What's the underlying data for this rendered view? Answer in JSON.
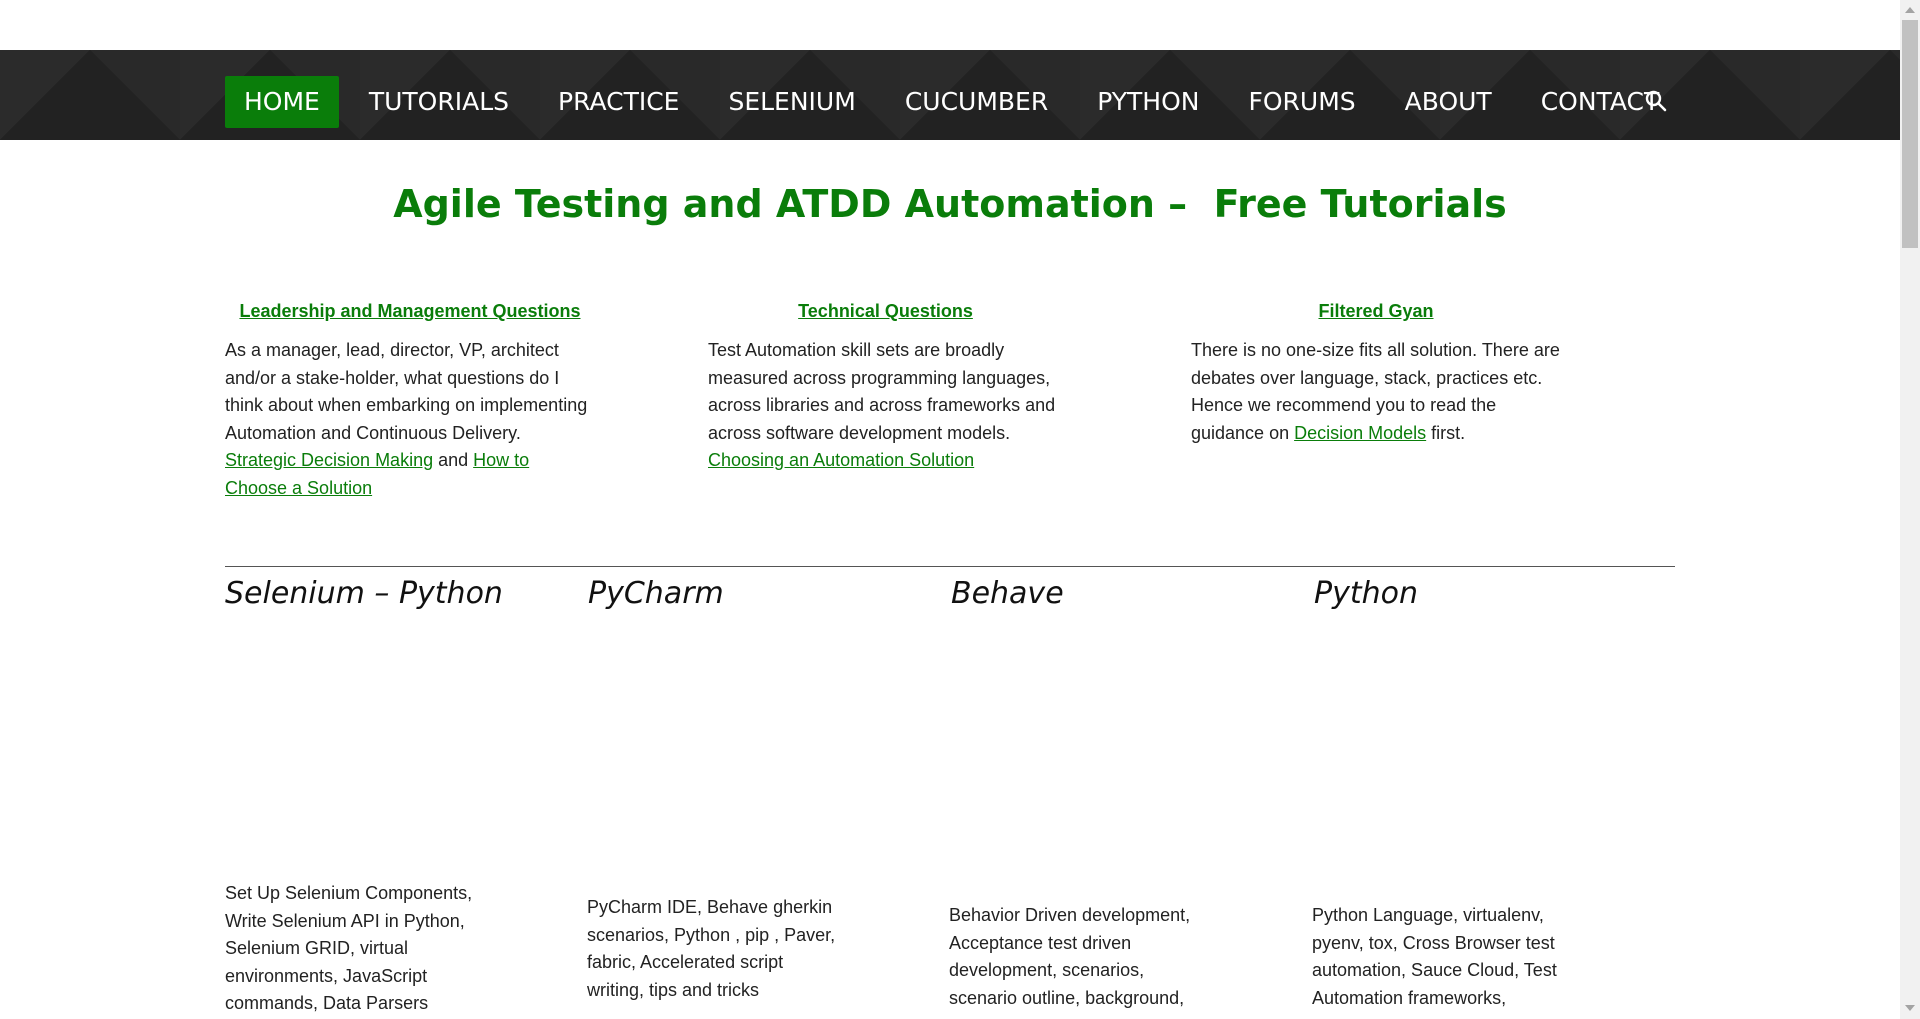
{
  "nav": {
    "items": [
      {
        "label": "HOME",
        "name": "nav-home"
      },
      {
        "label": "TUTORIALS",
        "name": "nav-tutorials"
      },
      {
        "label": "PRACTICE",
        "name": "nav-practice"
      },
      {
        "label": "SELENIUM",
        "name": "nav-selenium"
      },
      {
        "label": "CUCUMBER",
        "name": "nav-cucumber"
      },
      {
        "label": "PYTHON",
        "name": "nav-python"
      },
      {
        "label": "FORUMS",
        "name": "nav-forums"
      },
      {
        "label": "ABOUT",
        "name": "nav-about"
      },
      {
        "label": "CONTACT",
        "name": "nav-contact"
      }
    ],
    "search_icon": "search-icon"
  },
  "page_title": "Agile Testing and ATDD Automation –  Free Tutorials",
  "columns": {
    "leadership": {
      "heading": "Leadership and Management Questions",
      "text": "As a manager, lead, director, VP, architect and/or a stake-holder, what questions do I think about when embarking on implementing Automation and Continuous Delivery. ",
      "link1": "Strategic Decision Making",
      "joiner": " and ",
      "link2": "How to Choose a Solution"
    },
    "technical": {
      "heading": "Technical Questions",
      "text": "Test Automation skill sets are broadly measured across programming languages, across libraries and across frameworks and across software development models.",
      "link1": "Choosing an Automation Solution"
    },
    "gyan": {
      "heading": "Filtered Gyan",
      "text": "There is no one-size fits all solution. There are debates over language, stack, practices etc. Hence we recommend you to read the guidance on ",
      "link1": "Decision Models",
      "suffix": " first."
    }
  },
  "tiles": [
    {
      "title": "Selenium – Python",
      "desc": "Set Up Selenium Components, Write Selenium API in Python, Selenium GRID, virtual environments, JavaScript commands, Data Parsers"
    },
    {
      "title": "PyCharm",
      "desc": "PyCharm IDE, Behave gherkin scenarios, Python , pip , Paver, fabric, Accelerated script writing, tips and tricks"
    },
    {
      "title": "Behave",
      "desc": "Behavior Driven development, Acceptance test driven development, scenarios, scenario outline, background,"
    },
    {
      "title": "Python",
      "desc": "Python Language, virtualenv, pyenv, tox, Cross Browser test automation, Sauce Cloud, Test Automation frameworks,"
    }
  ]
}
